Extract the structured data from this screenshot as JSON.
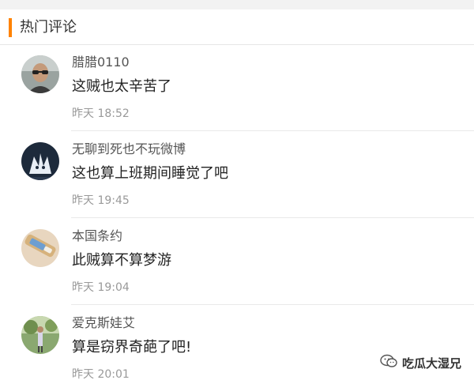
{
  "section": {
    "title": "热门评论",
    "accent_color": "#ff8200"
  },
  "comments": [
    {
      "username": "腊腊0110",
      "text": "这贼也太辛苦了",
      "time": "昨天 18:52",
      "avatar": "man-with-glasses-avatar"
    },
    {
      "username": "无聊到死也不玩微博",
      "text": "这也算上班期间睡觉了吧",
      "time": "昨天 19:45",
      "avatar": "dark-anime-avatar"
    },
    {
      "username": "本国条约",
      "text": "此贼算不算梦游",
      "time": "昨天 19:04",
      "avatar": "product-photo-avatar"
    },
    {
      "username": "爱克斯娃艾",
      "text": "算是窃界奇葩了吧!",
      "time": "昨天 20:01",
      "avatar": "person-outdoors-avatar"
    }
  ],
  "watermark": {
    "text": "吃瓜大湿兄",
    "icon": "wechat-icon"
  }
}
